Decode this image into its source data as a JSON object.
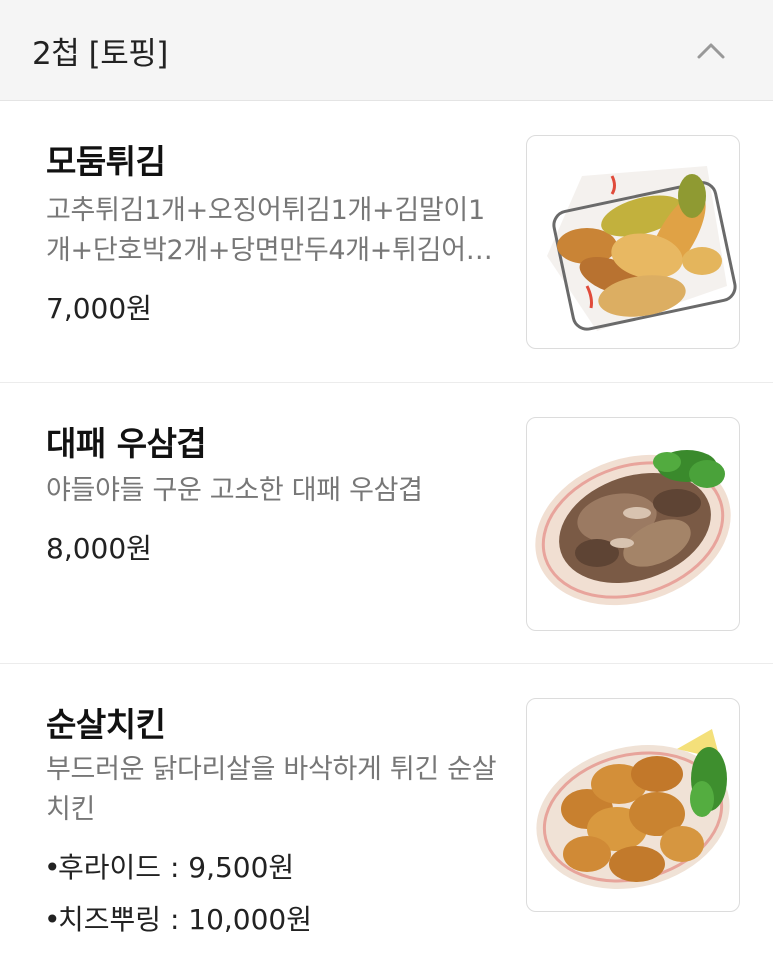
{
  "section": {
    "title": "2첩 [토핑]",
    "collapse_icon": "chevron-up-icon"
  },
  "items": [
    {
      "name": "모둠튀김",
      "description": "고추튀김1개+오징어튀김1개+김말이1개+단호박2개+당면만두4개+튀김어…",
      "price": "7,000원"
    },
    {
      "name": "대패 우삼겹",
      "description": "야들야들 구운 고소한 대패 우삼겹",
      "price": "8,000원"
    },
    {
      "name": "순살치킨",
      "description": "부드러운 닭다리살을 바삭하게 튀긴 순살치킨",
      "options": [
        {
          "bullet": "•",
          "label": "후라이드 : 9,500원"
        },
        {
          "bullet": "•",
          "label": "치즈뿌링 : 10,000원"
        }
      ]
    }
  ],
  "colors": {
    "header_bg": "#f5f5f5",
    "divider": "#ececec",
    "description": "#777777"
  }
}
